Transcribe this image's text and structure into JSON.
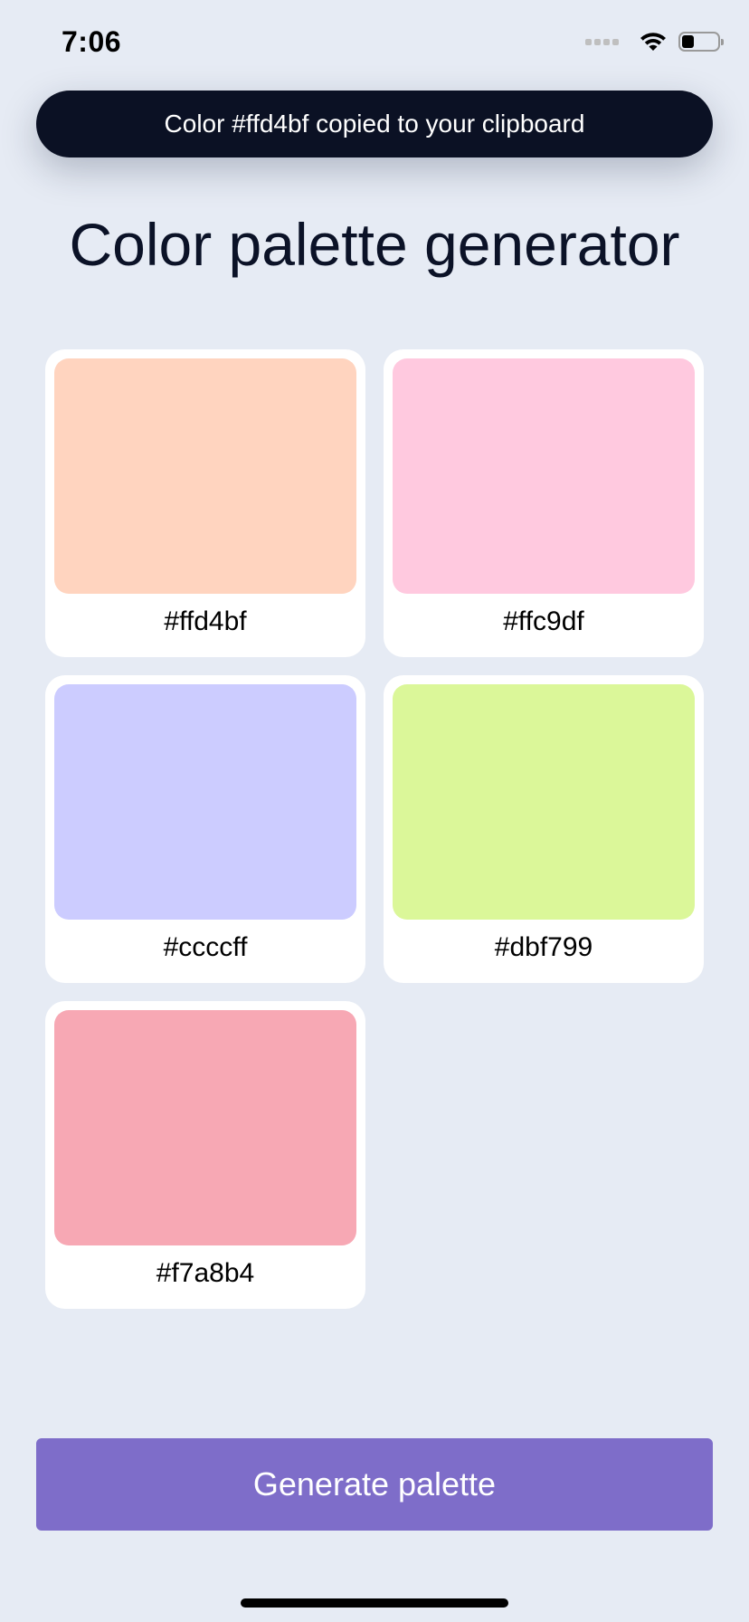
{
  "status_bar": {
    "time": "7:06",
    "signal_icon": "signal-dots-icon",
    "wifi_icon": "wifi-icon",
    "battery_icon": "battery-icon",
    "battery_level": 0.35
  },
  "toast": {
    "message": "Color #ffd4bf copied to your clipboard"
  },
  "page": {
    "title": "Color palette generator"
  },
  "palette": [
    {
      "hex": "#ffd4bf",
      "color": "#ffd4bf"
    },
    {
      "hex": "#ffc9df",
      "color": "#ffc9df"
    },
    {
      "hex": "#ccccff",
      "color": "#ccccff"
    },
    {
      "hex": "#dbf799",
      "color": "#dbf799"
    },
    {
      "hex": "#f7a8b4",
      "color": "#f7a8b4"
    }
  ],
  "actions": {
    "generate_label": "Generate palette"
  },
  "colors": {
    "background": "#e6ebf4",
    "toast_bg": "#0b1124",
    "button_bg": "#7e6dc9",
    "title_text": "#0b1227"
  }
}
